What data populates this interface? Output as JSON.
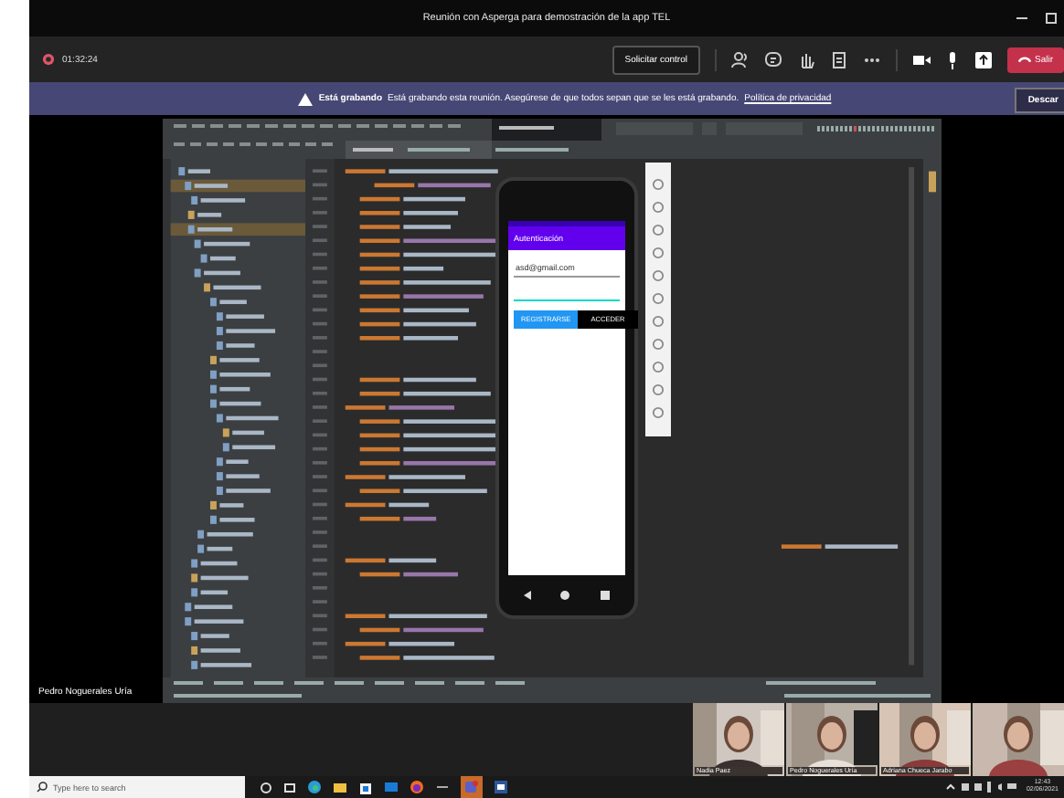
{
  "window": {
    "title": "Reunión con Asperga para demostración de la app TEL"
  },
  "meeting_bar": {
    "timer": "01:32:24",
    "request_control": "Solicitar control",
    "leave": "Salir"
  },
  "recording_banner": {
    "title": "Está grabando",
    "message": "Está grabando esta reunión. Asegúrese de que todos sepan que se les está grabando.",
    "link": "Política de privacidad",
    "dismiss": "Descar"
  },
  "shared_screen": {
    "presenter": "Pedro Noguerales Uría",
    "phone": {
      "app_title": "Autenticación",
      "email": "asd@gmail.com",
      "register": "REGISTRARSE",
      "login": "ACCEDER"
    }
  },
  "participants": [
    {
      "name": "Nadia Paez"
    },
    {
      "name": "Pedro Noguerales Uría"
    },
    {
      "name": "Adriana Chueca Jarabo"
    }
  ],
  "taskbar": {
    "search_placeholder": "Type here to search",
    "time": "12:43",
    "date": "02/06/2021"
  }
}
